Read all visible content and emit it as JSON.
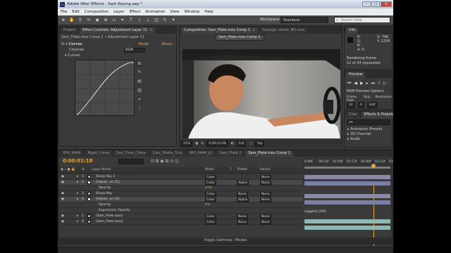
{
  "window": {
    "title": "Adobe After Effects - Sam Keying.aep *",
    "buttons": [
      "–",
      "▢",
      "✕"
    ]
  },
  "menu": [
    "File",
    "Edit",
    "Composition",
    "Layer",
    "Effect",
    "Animation",
    "View",
    "Window",
    "Help"
  ],
  "toolbar": {
    "workspace_label": "Workspace:",
    "workspace_value": "Standard",
    "search_placeholder": "Search Help"
  },
  "effect_controls": {
    "tabs": [
      "Project",
      "Effect Controls: Adjustment Layer 11"
    ],
    "header": "Sam_Plate.mov Comp 1 • Adjustment Layer 11",
    "effect_name": "Curves",
    "reset": "Reset",
    "about": "About...",
    "channel_label": "Channel:",
    "channel_value": "RGB",
    "curves_label": "Curves"
  },
  "composition": {
    "tabs": [
      "Composition: Sam_Plate.mov Comp 1",
      "Footage: street_BG.mov"
    ],
    "subtab": "Sam_Plate.mov Comp 1",
    "viewer_bar": [
      "25%",
      "0:00:01:08",
      "Full",
      "Top"
    ]
  },
  "info": {
    "tab": "Info",
    "values": [
      "R:",
      "G:",
      "B:",
      "A: 0"
    ],
    "xy": [
      "X: 796",
      "Y: 1258"
    ],
    "status1": "Rendering frame",
    "status2": "12 of 43 requested"
  },
  "preview": {
    "tab": "Preview",
    "ram_options": "RAM Preview Options",
    "cols": [
      "Frame Rate",
      "Skip",
      "Resolution"
    ],
    "vals": [
      "24",
      "0",
      "Half"
    ]
  },
  "effects_presets": {
    "tabs": [
      "Char",
      "Effects & Presets"
    ],
    "search": "ρ▾",
    "items": [
      "▸ Animation Presets",
      "▸ 3D Channel",
      "▸ Audio"
    ]
  },
  "timeline": {
    "tabs": [
      "MVI_6444",
      "Night_Comp",
      "Day_Time_Comp",
      "Cars_Shake_Turn",
      "MVI_6444_s1",
      "Sam_Plate 2",
      "Sam_Plate.mov Comp 1"
    ],
    "timecode": "0:00:01:18",
    "columns": {
      "num": "#",
      "name": "Layer Name",
      "mode": "Mode",
      "t": "T",
      "trkmat": "TrkMat",
      "parent": "Parent"
    },
    "ruler": [
      "0:00f",
      "00:12f",
      "01:00f",
      "01:12f",
      "02:00f",
      "02:12f",
      "03:00f"
    ],
    "rows": [
      {
        "num": "1",
        "name": "Sharp Key 2",
        "mode": "Color",
        "trkmat": "",
        "parent": "None",
        "color": "#c9a0c0"
      },
      {
        "num": "2",
        "name": "[Adjust...er 11]",
        "mode": "Color",
        "trkmat": "Alpha",
        "parent": "None",
        "color": "#ffffff"
      },
      {
        "num": "",
        "name": "Opacity",
        "mode": "41%",
        "trkmat": "",
        "parent": "",
        "color": ""
      },
      {
        "num": "3",
        "name": "Sharp Key",
        "mode": "Color",
        "trkmat": "None",
        "parent": "None",
        "color": "#c9a0c0"
      },
      {
        "num": "4",
        "name": "[Adjust...er 11]",
        "mode": "Color",
        "trkmat": "Alpha",
        "parent": "None",
        "color": "#ffffff"
      },
      {
        "num": "",
        "name": "Opacity",
        "mode": "0%",
        "trkmat": "",
        "parent": "",
        "color": ""
      },
      {
        "num": "",
        "name": "Expression: Opacity",
        "mode": "",
        "trkmat": "",
        "parent": "",
        "color": ""
      },
      {
        "num": "5",
        "name": "[Sam_Plate.mov]",
        "mode": "Color",
        "trkmat": "None",
        "parent": "None",
        "color": "#8fb8b5"
      },
      {
        "num": "6",
        "name": "[Sam_Plate.mov]",
        "mode": "Color",
        "trkmat": "None",
        "parent": "None",
        "color": "#8fb8b5"
      }
    ],
    "expression": "wiggle(2,200)",
    "toggle": "Toggle Switches / Modes"
  }
}
